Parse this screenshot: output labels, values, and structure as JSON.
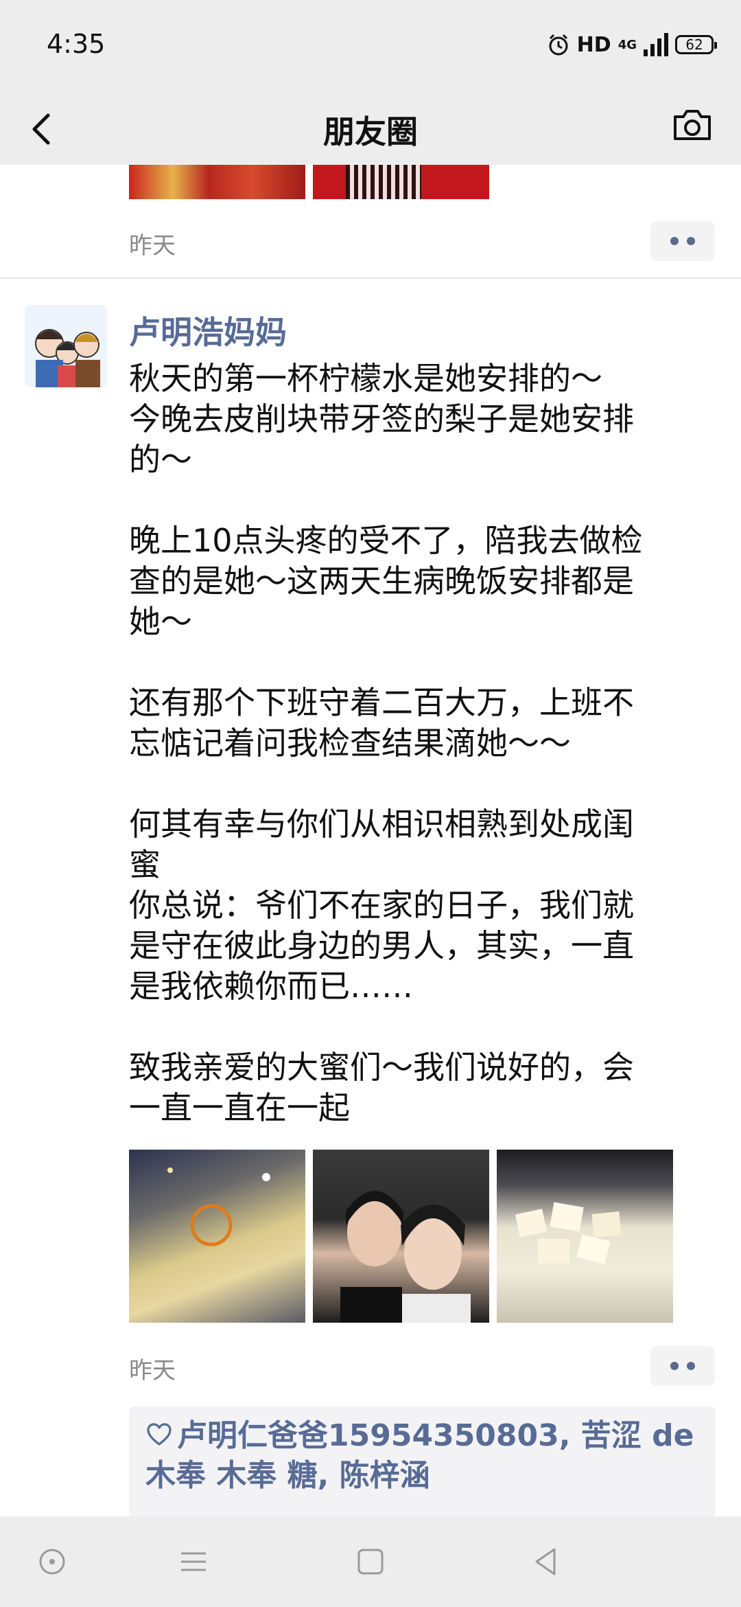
{
  "status_bar": {
    "time": "4:35",
    "hd": "HD",
    "network": "4G",
    "battery": "62"
  },
  "nav": {
    "title": "朋友圈"
  },
  "previous_post": {
    "time": "昨天"
  },
  "post": {
    "name": "卢明浩妈妈",
    "text_lines": [
      "秋天的第一杯柠檬水是她安排的～",
      "今晚去皮削块带牙签的梨子是她安排",
      "的～",
      "",
      "晚上10点头疼的受不了，陪我去做检",
      "查的是她～这两天生病晚饭安排都是",
      "她～",
      "",
      "还有那个下班守着二百大万，上班不",
      "忘惦记着问我检查结果滴她～～",
      "",
      "何其有幸与你们从相识相熟到处成闺",
      "蜜",
      "你总说：爷们不在家的日子，我们就",
      "是守在彼此身边的男人，其实，一直",
      "是我依赖你而已……",
      "",
      "致我亲爱的大蜜们～我们说好的，会",
      "一直一直在一起"
    ],
    "time": "昨天",
    "likes": "卢明仁爸爸15954350803, 苦涩 de 木奉 木奉 糖, 陈梓涵"
  },
  "colors": {
    "link": "#576b95",
    "bar_bg": "#ededed",
    "muted": "#8a8a8a"
  },
  "icons": {
    "back": "chevron-left-icon",
    "camera": "camera-icon",
    "heart": "heart-icon"
  }
}
